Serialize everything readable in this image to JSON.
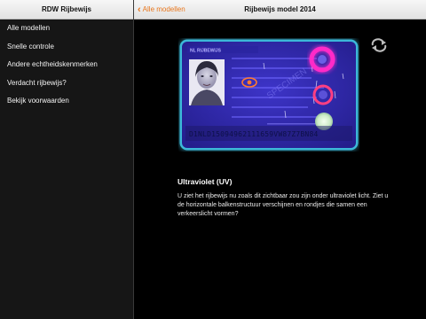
{
  "sidebar": {
    "title": "RDW Rijbewijs",
    "items": [
      {
        "label": "Alle modellen"
      },
      {
        "label": "Snelle controle"
      },
      {
        "label": "Andere echtheidskenmerken"
      },
      {
        "label": "Verdacht rijbewijs?"
      },
      {
        "label": "Bekijk voorwaarden"
      }
    ]
  },
  "detail": {
    "back_label": "Alle modellen",
    "title": "Rijbewijs model 2014",
    "card": {
      "header_text": "NL RIJBEWIJS",
      "mrz": "D1NLD15094962111659VW87Z7BN84",
      "watermark": "SPECIMEN",
      "colors": {
        "card": "#312ab0",
        "glow": "#46d9ff",
        "uv_ring_top": "#ff2bc8",
        "uv_ring_mid": "#ff3f82",
        "uv_light_bottom": "#d9ffd4",
        "mrz": "#0d1048"
      },
      "rotate_icon": "rotate-arrows-icon"
    },
    "section_title": "Ultraviolet (UV)",
    "description": "U ziet het rijbewijs nu zoals dit zichtbaar zou zijn onder ultraviolet licht. Ziet u de horizontale balkenstructuur verschijnen en rondjes die samen een verkeerslicht vormen?"
  },
  "accent_color": "#e8771e"
}
